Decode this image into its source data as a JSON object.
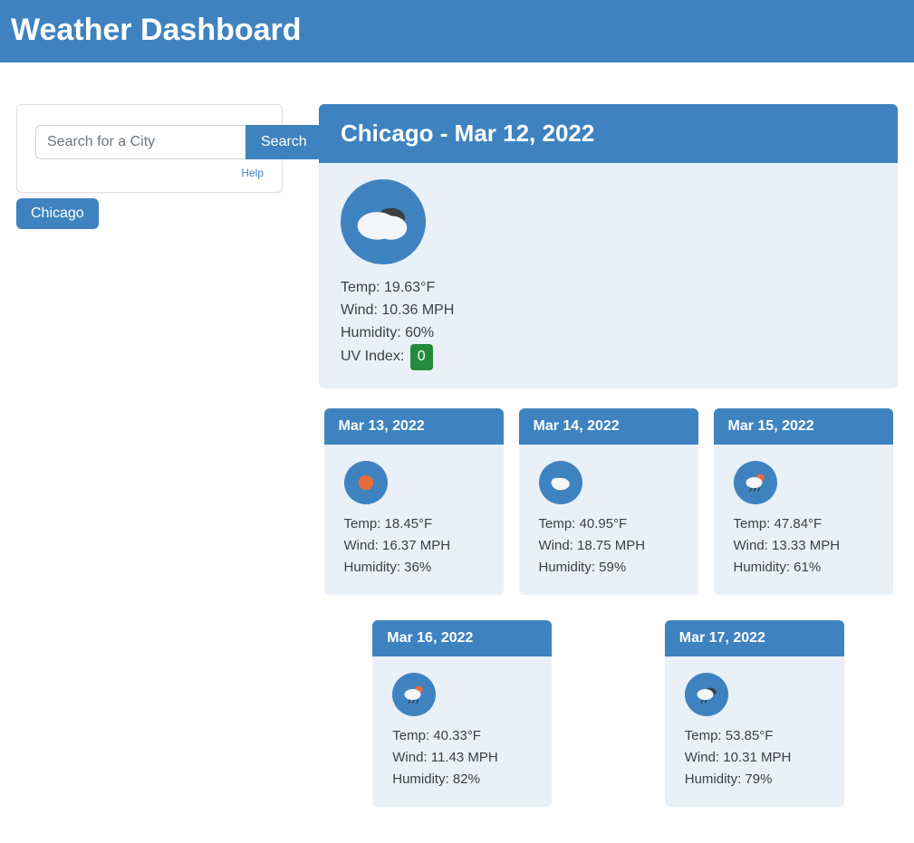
{
  "header": {
    "title": "Weather Dashboard"
  },
  "search": {
    "placeholder": "Search for a City",
    "value": "",
    "button_label": "Search",
    "help_label": "Help"
  },
  "history": {
    "items": [
      {
        "label": "Chicago"
      }
    ]
  },
  "today": {
    "title": "Chicago - Mar 12, 2022",
    "icon": "clouds",
    "temp_label": "Temp: 19.63°F",
    "wind_label": "Wind: 10.36 MPH",
    "humidity_label": "Humidity: 60%",
    "uv_prefix": "UV Index: ",
    "uv_value": "0"
  },
  "forecast": [
    {
      "date": "Mar 13, 2022",
      "icon": "clear-sun",
      "temp": "Temp: 18.45°F",
      "wind": "Wind: 16.37 MPH",
      "humidity": "Humidity: 36%"
    },
    {
      "date": "Mar 14, 2022",
      "icon": "cloud-simple",
      "temp": "Temp: 40.95°F",
      "wind": "Wind: 18.75 MPH",
      "humidity": "Humidity: 59%"
    },
    {
      "date": "Mar 15, 2022",
      "icon": "rain-sun",
      "temp": "Temp: 47.84°F",
      "wind": "Wind: 13.33 MPH",
      "humidity": "Humidity: 61%"
    },
    {
      "date": "Mar 16, 2022",
      "icon": "rain-sun",
      "temp": "Temp: 40.33°F",
      "wind": "Wind: 11.43 MPH",
      "humidity": "Humidity: 82%"
    },
    {
      "date": "Mar 17, 2022",
      "icon": "rain-cloud",
      "temp": "Temp: 53.85°F",
      "wind": "Wind: 10.31 MPH",
      "humidity": "Humidity: 79%"
    }
  ]
}
